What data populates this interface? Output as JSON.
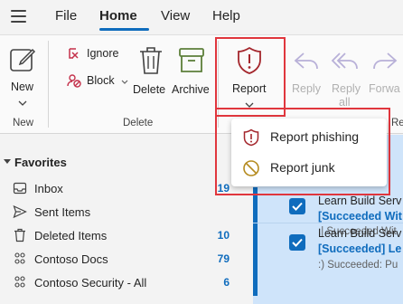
{
  "menu": {
    "tabs": [
      {
        "label": "File"
      },
      {
        "label": "Home"
      },
      {
        "label": "View"
      },
      {
        "label": "Help"
      }
    ]
  },
  "ribbon": {
    "new": {
      "label": "New",
      "group": "New"
    },
    "delete_group": {
      "ignore": "Ignore",
      "block": "Block",
      "delete": "Delete",
      "archive": "Archive",
      "group": "Delete"
    },
    "report": {
      "label": "Report"
    },
    "respond": {
      "reply": "Reply",
      "reply_all_line1": "Reply",
      "reply_all_line2": "all",
      "forward": "Forwa",
      "group": "Re"
    }
  },
  "report_menu": {
    "items": [
      {
        "label": "Report phishing",
        "icon": "shield-alert-icon",
        "color": "#a4262c"
      },
      {
        "label": "Report junk",
        "icon": "junk-icon",
        "color": "#b58b1f"
      }
    ]
  },
  "favorites": {
    "title": "Favorites",
    "folders": [
      {
        "label": "Inbox",
        "count": "19",
        "icon": "inbox-icon"
      },
      {
        "label": "Sent Items",
        "count": "",
        "icon": "send-icon"
      },
      {
        "label": "Deleted Items",
        "count": "10",
        "icon": "trash-icon"
      },
      {
        "label": "Contoso Docs",
        "count": "79",
        "icon": "group-icon"
      },
      {
        "label": "Contoso Security - All",
        "count": "6",
        "icon": "group-icon"
      }
    ]
  },
  "messages": [
    {
      "sender": "Learn Build Serv",
      "subject": "[Succeeded Wit",
      "preview": ":| Succeeded Wit"
    },
    {
      "sender": "Learn Build Serv",
      "subject": "[Succeeded] Le",
      "preview": ":) Succeeded: Pu"
    }
  ],
  "colors": {
    "accent": "#0f6cbd",
    "highlight": "#e0363d",
    "selected_bg": "#cfe4fa"
  }
}
